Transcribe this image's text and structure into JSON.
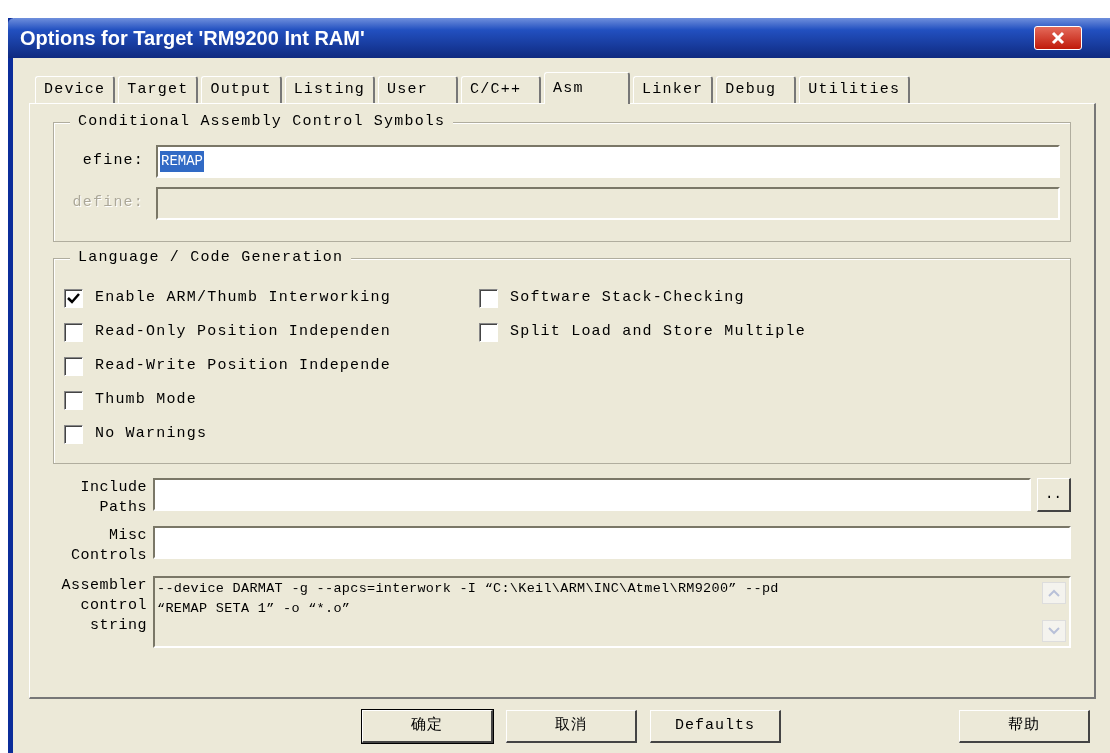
{
  "window": {
    "title": "Options for Target 'RM9200 Int RAM'"
  },
  "tabs": [
    {
      "label": "Device",
      "selected": false
    },
    {
      "label": "Target",
      "selected": false
    },
    {
      "label": "Output",
      "selected": false
    },
    {
      "label": "Listing",
      "selected": false
    },
    {
      "label": "User",
      "selected": false
    },
    {
      "label": "C/C++",
      "selected": false
    },
    {
      "label": "Asm",
      "selected": true
    },
    {
      "label": "Linker",
      "selected": false
    },
    {
      "label": "Debug",
      "selected": false
    },
    {
      "label": "Utilities",
      "selected": false
    }
  ],
  "symbols_group": {
    "legend": "Conditional Assembly Control Symbols",
    "fields": [
      {
        "label": "efine:",
        "value": "REMAP",
        "disabled": false,
        "text_selected": true
      },
      {
        "label": "define:",
        "disabled": true
      }
    ]
  },
  "language_group": {
    "legend": "Language / Code Generation",
    "left_options": [
      {
        "label": "Enable ARM/Thumb Interworking",
        "checked": true
      },
      {
        "label": "Read-Only Position Independen",
        "checked": false
      },
      {
        "label": "Read-Write Position Independe",
        "checked": false
      },
      {
        "label": "Thumb Mode",
        "checked": false
      },
      {
        "label": "No Warnings",
        "checked": false
      }
    ],
    "right_options": [
      {
        "label": "Software Stack-Checking",
        "checked": false
      },
      {
        "label": "Split Load and Store Multiple",
        "checked": false
      }
    ]
  },
  "include_paths": {
    "label_lines": [
      "Include",
      "Paths"
    ],
    "browse_button": ".."
  },
  "misc_controls": {
    "label_lines": [
      "Misc",
      "Controls"
    ]
  },
  "assembler_string": {
    "label_lines": [
      "Assembler",
      "control",
      "string"
    ],
    "lines": [
      "--device DARMAT -g --apcs=interwork -I “C:\\Keil\\ARM\\INC\\Atmel\\RM9200” --pd",
      "“REMAP SETA 1” -o “*.o”"
    ]
  },
  "buttons": [
    {
      "label": "确定",
      "default": true
    },
    {
      "label": "取消",
      "default": false
    },
    {
      "label": "Defaults",
      "default": false
    },
    {
      "label": "帮助",
      "default": false
    }
  ]
}
